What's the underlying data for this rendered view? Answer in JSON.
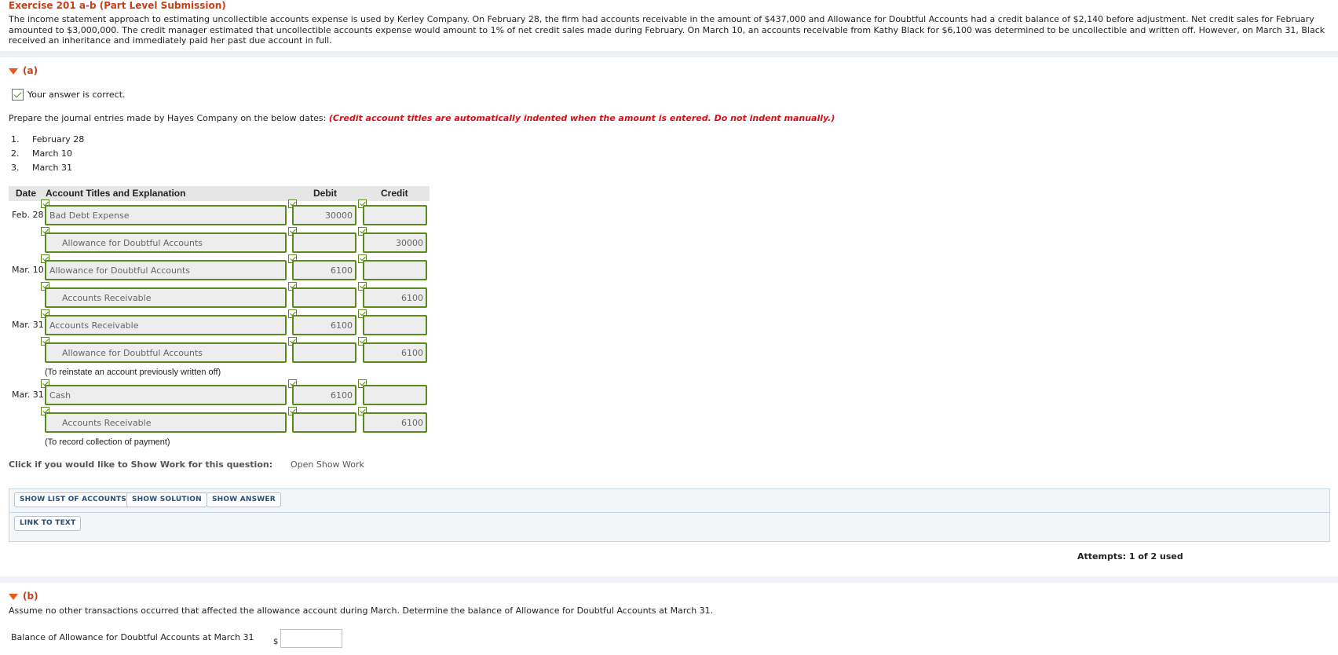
{
  "exercise": {
    "title": "Exercise 201 a-b (Part Level Submission)",
    "intro": "The income statement approach to estimating uncollectible accounts expense is used by Kerley Company. On February 28, the firm had accounts receivable in the amount of $437,000 and Allowance for Doubtful Accounts had a credit balance of $2,140 before adjustment. Net credit sales for February amounted to $3,000,000. The credit manager estimated that uncollectible accounts expense would amount to 1% of net credit sales made during February. On March 10, an accounts receivable from Kathy Black for $6,100 was determined to be uncollectible and written off. However, on March 31, Black received an inheritance and immediately paid her past due account in full."
  },
  "part_a": {
    "label": "(a)",
    "feedback": "Your answer is correct.",
    "prompt": "Prepare the journal entries made by Hayes Company on the below dates:",
    "prompt_note": "(Credit account titles are automatically indented when the amount is entered. Do not indent manually.)",
    "dates_list": [
      {
        "num": "1.",
        "text": "February 28"
      },
      {
        "num": "2.",
        "text": "March 10"
      },
      {
        "num": "3.",
        "text": "March 31"
      }
    ],
    "table_headers": {
      "date": "Date",
      "account": "Account Titles and Explanation",
      "debit": "Debit",
      "credit": "Credit"
    },
    "rows": [
      {
        "date": "Feb. 28",
        "account": "Bad Debt Expense",
        "debit": "30000",
        "credit": ""
      },
      {
        "date": "",
        "account": "Allowance for Doubtful Accounts",
        "debit": "",
        "credit": "30000"
      },
      {
        "date": "Mar. 10",
        "account": "Allowance for Doubtful Accounts",
        "debit": "6100",
        "credit": ""
      },
      {
        "date": "",
        "account": "Accounts Receivable",
        "debit": "",
        "credit": "6100"
      },
      {
        "date": "Mar. 31",
        "account": "Accounts Receivable",
        "debit": "6100",
        "credit": ""
      },
      {
        "date": "",
        "account": "Allowance for Doubtful Accounts",
        "debit": "",
        "credit": "6100"
      },
      {
        "date": "Mar. 31",
        "account": "Cash",
        "debit": "6100",
        "credit": ""
      },
      {
        "date": "",
        "account": "Accounts Receivable",
        "debit": "",
        "credit": "6100"
      }
    ],
    "notes": [
      "(To reinstate an account previously written off)",
      "(To record collection of payment)"
    ],
    "show_work_label": "Click if you would like to Show Work for this question:",
    "show_work_link": "Open Show Work",
    "buttons": {
      "show_list": "SHOW LIST OF ACCOUNTS",
      "show_solution": "SHOW SOLUTION",
      "show_answer": "SHOW ANSWER",
      "link_to_text": "LINK TO TEXT"
    },
    "attempts": "Attempts: 1 of 2 used"
  },
  "part_b": {
    "label": "(b)",
    "prompt": "Assume no other transactions occurred that affected the allowance account during March. Determine the balance of Allowance for Doubtful Accounts at March 31.",
    "field_label": "Balance of Allowance for Doubtful Accounts at March 31",
    "currency": "$",
    "value": ""
  }
}
